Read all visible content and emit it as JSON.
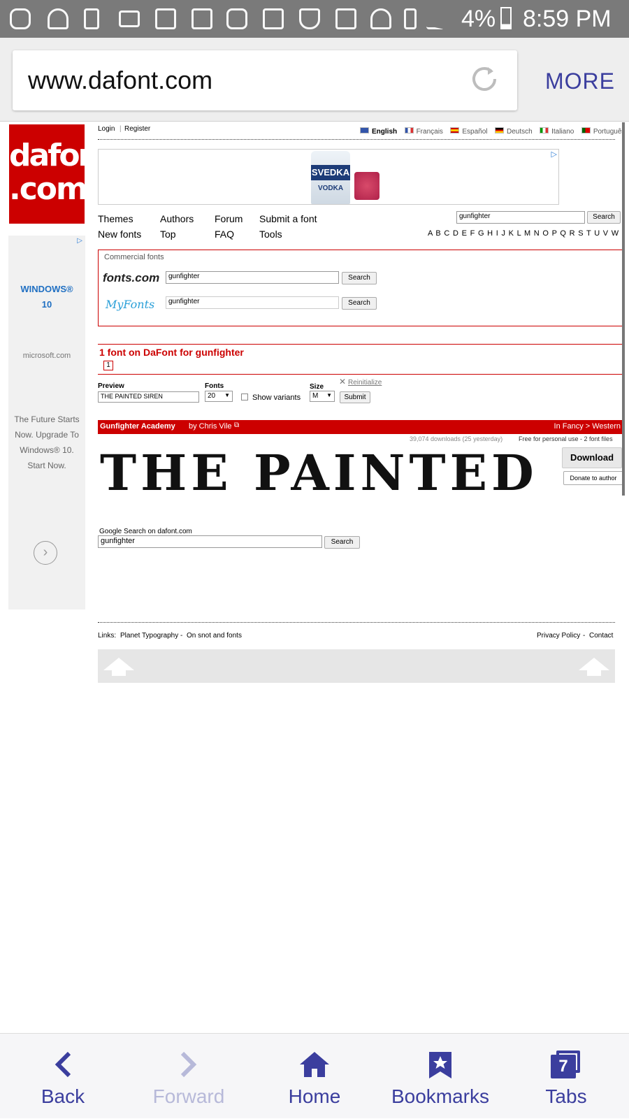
{
  "status_bar": {
    "battery": "4%",
    "time": "8:59 PM"
  },
  "browser": {
    "url": "www.dafont.com",
    "more_label": "MORE"
  },
  "site": {
    "logo_line1": "dafont",
    "logo_line2": ".com",
    "login": "Login",
    "register": "Register",
    "languages": [
      "English",
      "Français",
      "Español",
      "Deutsch",
      "Italiano",
      "Português"
    ],
    "banner_brand": "SVEDKA",
    "banner_product": "VODKA",
    "nav": {
      "themes": "Themes",
      "authors": "Authors",
      "forum": "Forum",
      "submit_font": "Submit a font",
      "new_fonts": "New fonts",
      "top": "Top",
      "faq": "FAQ",
      "tools": "Tools"
    },
    "search_value": "gunfighter",
    "search_button": "Search",
    "alphabet": "A B C D E F G H I J K L M N O P Q R S T U V W X Y Z #",
    "commercial": {
      "title": "Commercial fonts",
      "fontscom_logo": "fonts.com",
      "myfonts_logo": "MyFonts",
      "fontscom_value": "gunfighter",
      "myfonts_value": "gunfighter",
      "search_button": "Search"
    },
    "result_title": "1 font on DaFont for gunfighter",
    "page_number": "1",
    "options": {
      "preview_label": "Preview",
      "preview_value": "THE PAINTED SIREN",
      "fonts_label": "Fonts",
      "fonts_value": "20",
      "show_variants": "Show variants",
      "size_label": "Size",
      "size_value": "M",
      "reinitialize": "Reinitialize",
      "submit": "Submit"
    },
    "font_entry": {
      "name": "Gunfighter Academy",
      "by": "by Chris Vile",
      "category": "In Fancy > Western",
      "downloads": "39,074 downloads (25 yesterday)",
      "license": "Free for personal use - 2 font files",
      "preview_text": "THE PAINTED S",
      "download_button": "Download",
      "donate_button": "Donate to author"
    },
    "google": {
      "label": "Google Search on dafont.com",
      "value": "gunfighter",
      "button": "Search"
    },
    "footer": {
      "links_label": "Links:",
      "link1": "Planet Typography",
      "link2": "On snot and fonts",
      "privacy": "Privacy Policy",
      "contact": "Contact"
    }
  },
  "side_ad": {
    "title": "WINDOWS® 10",
    "domain": "microsoft.com",
    "text": "The Future Starts Now. Upgrade To Windows® 10. Start Now."
  },
  "bottom_nav": {
    "back": "Back",
    "forward": "Forward",
    "home": "Home",
    "bookmarks": "Bookmarks",
    "tabs": "Tabs",
    "tab_count": "7"
  }
}
